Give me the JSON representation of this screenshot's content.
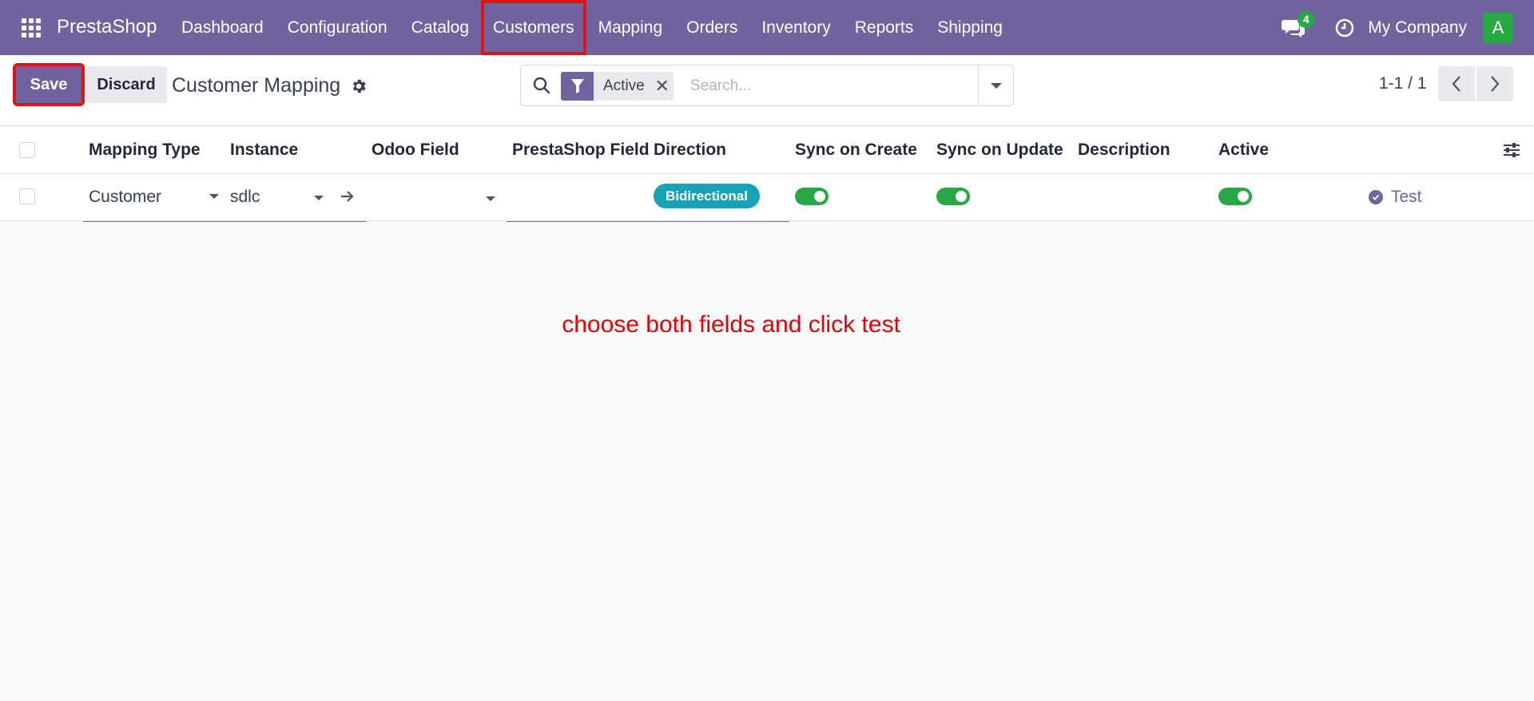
{
  "navbar": {
    "brand": "PrestaShop",
    "menu": [
      "Dashboard",
      "Configuration",
      "Catalog",
      "Customers",
      "Mapping",
      "Orders",
      "Inventory",
      "Reports",
      "Shipping"
    ],
    "messages_count": "4",
    "company": "My Company",
    "avatar_letter": "A",
    "colors": {
      "bar": "#71639e",
      "badge": "#28a745"
    }
  },
  "control": {
    "save_label": "Save",
    "discard_label": "Discard",
    "title": "Customer Mapping",
    "search": {
      "facet_label": "Active",
      "placeholder": "Search..."
    },
    "pager": "1-1 / 1"
  },
  "table": {
    "columns": [
      "Mapping Type",
      "Instance",
      "Odoo Field",
      "PrestaShop Field",
      "Direction",
      "Sync on Create",
      "Sync on Update",
      "Description",
      "Active"
    ],
    "row": {
      "mapping_type": "Customer",
      "instance": "sdlc",
      "odoo_field": "",
      "prestashop_field": "",
      "direction": "Bidirectional",
      "sync_on_create": true,
      "sync_on_update": true,
      "description": "",
      "active": true,
      "test_label": "Test"
    }
  },
  "annotation": "choose both fields and click test"
}
